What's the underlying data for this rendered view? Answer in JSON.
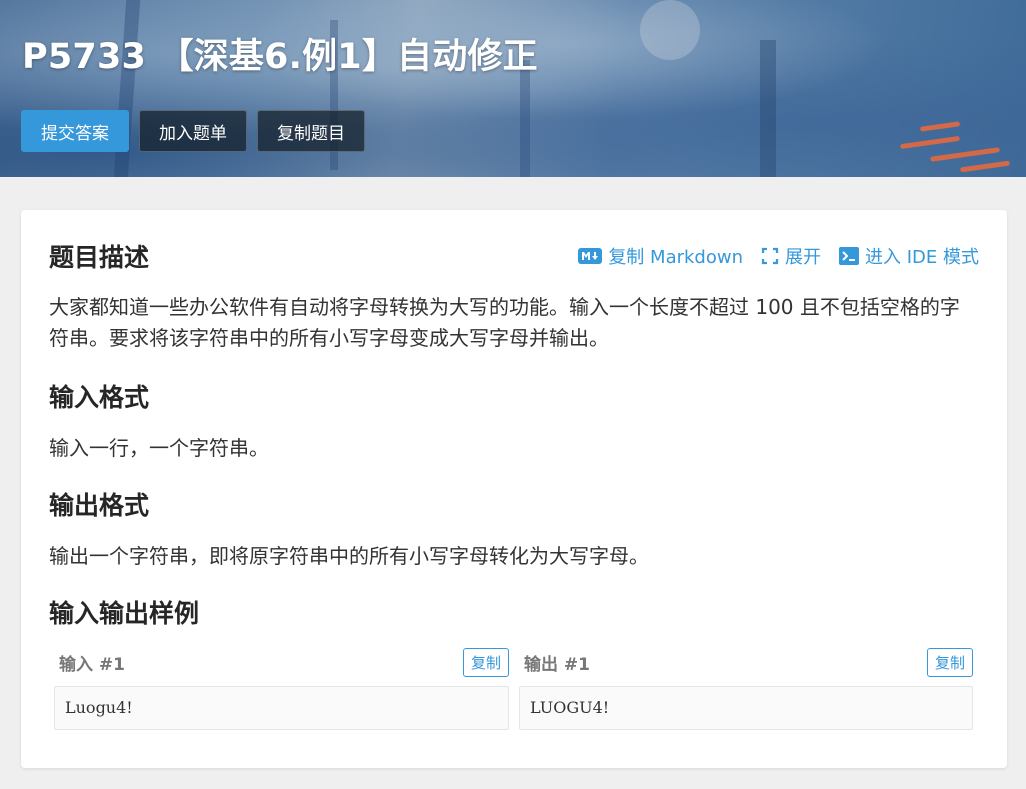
{
  "header": {
    "title": "P5733 【深基6.例1】自动修正",
    "buttons": {
      "submit": "提交答案",
      "add_to_list": "加入题单",
      "copy_problem": "复制题目"
    }
  },
  "toolbar": {
    "copy_markdown": "复制 Markdown",
    "expand": "展开",
    "ide_mode": "进入 IDE 模式"
  },
  "sections": {
    "description": {
      "heading": "题目描述",
      "text": "大家都知道一些办公软件有自动将字母转换为大写的功能。输入一个长度不超过 100 且不包括空格的字符串。要求将该字符串中的所有小写字母变成大写字母并输出。"
    },
    "input_format": {
      "heading": "输入格式",
      "text": "输入一行，一个字符串。"
    },
    "output_format": {
      "heading": "输出格式",
      "text": "输出一个字符串，即将原字符串中的所有小写字母转化为大写字母。"
    },
    "samples": {
      "heading": "输入输出样例",
      "input_label": "输入 #1",
      "output_label": "输出 #1",
      "copy_label": "复制",
      "input_value": "Luogu4!",
      "output_value": "LUOGU4!"
    }
  },
  "colors": {
    "accent": "#3498db",
    "page_bg": "#efefef",
    "card_bg": "#ffffff"
  },
  "icons": [
    "markdown-icon",
    "expand-icon",
    "terminal-icon"
  ]
}
